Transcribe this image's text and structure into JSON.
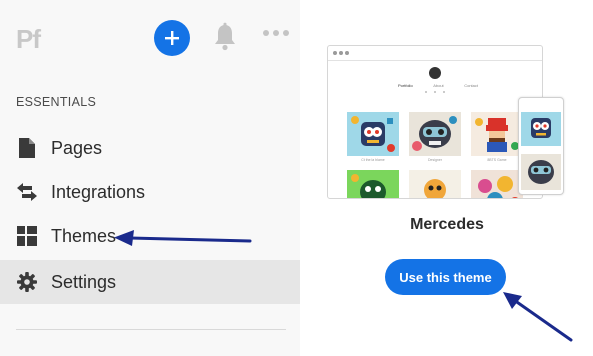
{
  "app": {
    "logo_text": "Pf"
  },
  "header": {
    "add_icon": "plus-icon",
    "notifications_icon": "bell-icon",
    "more_icon": "more-horizontal-icon"
  },
  "sidebar": {
    "section_title": "ESSENTIALS",
    "items": [
      {
        "label": "Pages",
        "icon": "page-icon"
      },
      {
        "label": "Integrations",
        "icon": "arrows-exchange-icon"
      },
      {
        "label": "Themes",
        "icon": "layout-grid-icon"
      },
      {
        "label": "Settings",
        "icon": "gear-icon",
        "active": true
      }
    ]
  },
  "preview": {
    "site_tabs": [
      "Portfolio",
      "About",
      "Contact"
    ],
    "thumb_captions": [
      "Ct the la blame",
      "Designer",
      "8BTS Game"
    ]
  },
  "theme": {
    "name": "Mercedes",
    "use_button_label": "Use this theme"
  },
  "colors": {
    "accent": "#1473e6",
    "annotation_arrow": "#1a2a8c",
    "sidebar_bg": "#f8f8f8",
    "active_item_bg": "#e6e6e6"
  }
}
